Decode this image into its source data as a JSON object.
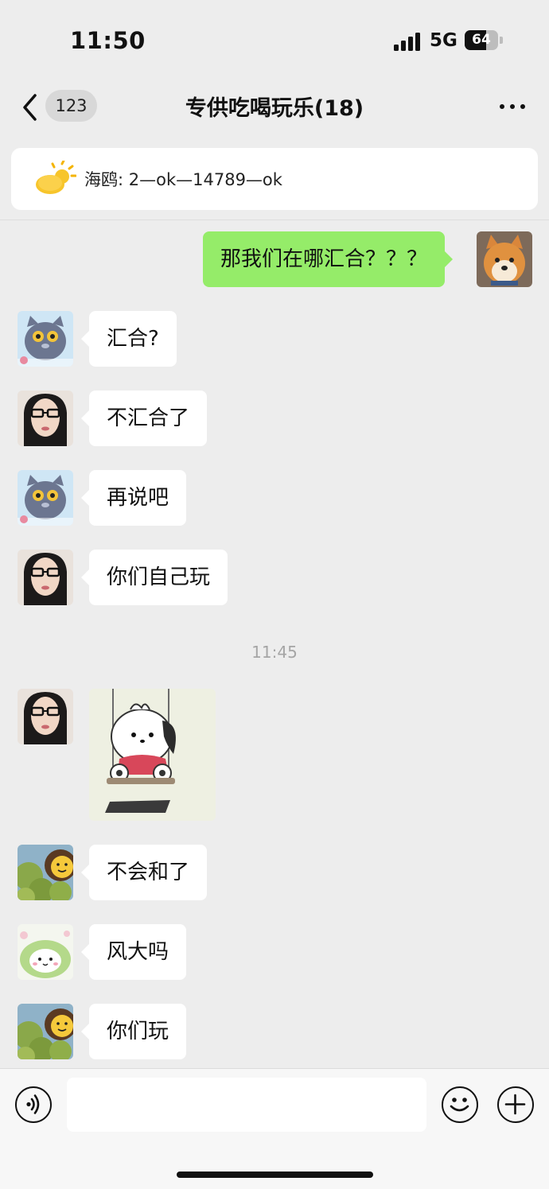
{
  "status_bar": {
    "time": "11:50",
    "network": "5G",
    "battery": "64",
    "battery_level": 0.64
  },
  "header": {
    "unread_count": "123",
    "title": "专供吃喝玩乐(18)"
  },
  "pinned": {
    "text": "海鸥: 2—ok—14789—ok"
  },
  "messages": [
    {
      "side": "right",
      "text": "那我们在哪汇合？？？",
      "avatar": "shiba-dog-avatar"
    },
    {
      "side": "left",
      "text": "汇合?",
      "avatar": "cartoon-cat-avatar"
    },
    {
      "side": "left",
      "text": "不汇合了",
      "avatar": "girl-glasses-avatar"
    },
    {
      "side": "left",
      "text": "再说吧",
      "avatar": "cartoon-cat-avatar"
    },
    {
      "side": "left",
      "text": "你们自己玩",
      "avatar": "girl-glasses-avatar"
    },
    {
      "side": "left",
      "text": "不会和了",
      "avatar": "smiley-tree-avatar"
    },
    {
      "side": "left",
      "text": "风大吗",
      "avatar": "green-creature-avatar"
    },
    {
      "side": "left",
      "text": "你们玩",
      "avatar": "smiley-tree-avatar"
    }
  ],
  "timestamp": "11:45",
  "sticker": {
    "name": "pochacco-swing-sticker",
    "sender_avatar": "girl-glasses-avatar"
  },
  "input_bar": {
    "placeholder": ""
  },
  "colors": {
    "background": "#ededed",
    "sent_bubble": "#95ec69",
    "received_bubble": "#ffffff"
  }
}
